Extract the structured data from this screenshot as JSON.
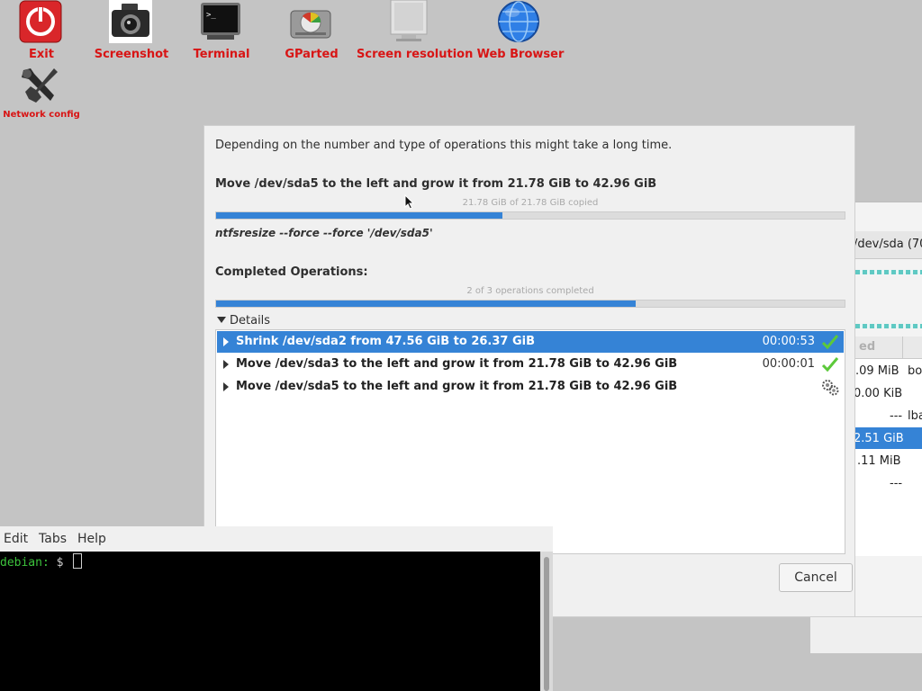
{
  "desktop": {
    "icons": [
      {
        "label": "Exit",
        "icon": "power-icon"
      },
      {
        "label": "Screenshot",
        "icon": "camera-icon"
      },
      {
        "label": "Terminal",
        "icon": "terminal-icon"
      },
      {
        "label": "GParted",
        "icon": "hard-disk-icon"
      },
      {
        "label": "Screen resolution",
        "icon": "monitor-icon"
      },
      {
        "label": "Web Browser",
        "icon": "globe-icon"
      },
      {
        "label": "Network config",
        "icon": "tools-icon"
      }
    ],
    "label_color": "#d81515"
  },
  "gparted_bg": {
    "device_fragment": "/dev/sda (70.(",
    "column_fragment": "ed",
    "rows": [
      {
        "used": ".09 MiB",
        "flags": "bo"
      },
      {
        "used": "0.00 KiB",
        "flags": ""
      },
      {
        "used": "---",
        "flags": "lba"
      },
      {
        "used": "2.51 GiB",
        "flags": ""
      },
      {
        "used": ".11 MiB",
        "flags": ""
      },
      {
        "used": "---",
        "flags": ""
      }
    ]
  },
  "dialog": {
    "intro": "Depending on the number and type of operations this might take a long time.",
    "current_op": "Move /dev/sda5 to the left and grow it from 21.78 GiB to 42.96 GiB",
    "current_progress_text": "21.78 GiB of 21.78 GiB copied",
    "current_progress": 0.455,
    "command": "ntfsresize --force --force '/dev/sda5'",
    "completed_label": "Completed Operations:",
    "completed_progress_text": "2 of 3 operations completed",
    "completed_progress": 0.667,
    "details_label": "Details",
    "operations": [
      {
        "text": "Shrink /dev/sda2 from 47.56 GiB to 26.37 GiB",
        "time": "00:00:53",
        "status": "check-icon"
      },
      {
        "text": "Move /dev/sda3 to the left and grow it from 21.78 GiB to 42.96 GiB",
        "time": "00:00:01",
        "status": "check-icon"
      },
      {
        "text": "Move /dev/sda5 to the left and grow it from 21.78 GiB to 42.96 GiB",
        "time": "",
        "status": "gears-icon"
      }
    ],
    "cancel_label": "Cancel",
    "accent_color": "#3583d6"
  },
  "terminal": {
    "menu": [
      "Edit",
      "Tabs",
      "Help"
    ],
    "host": "debian:",
    "prompt_sign": "$"
  }
}
